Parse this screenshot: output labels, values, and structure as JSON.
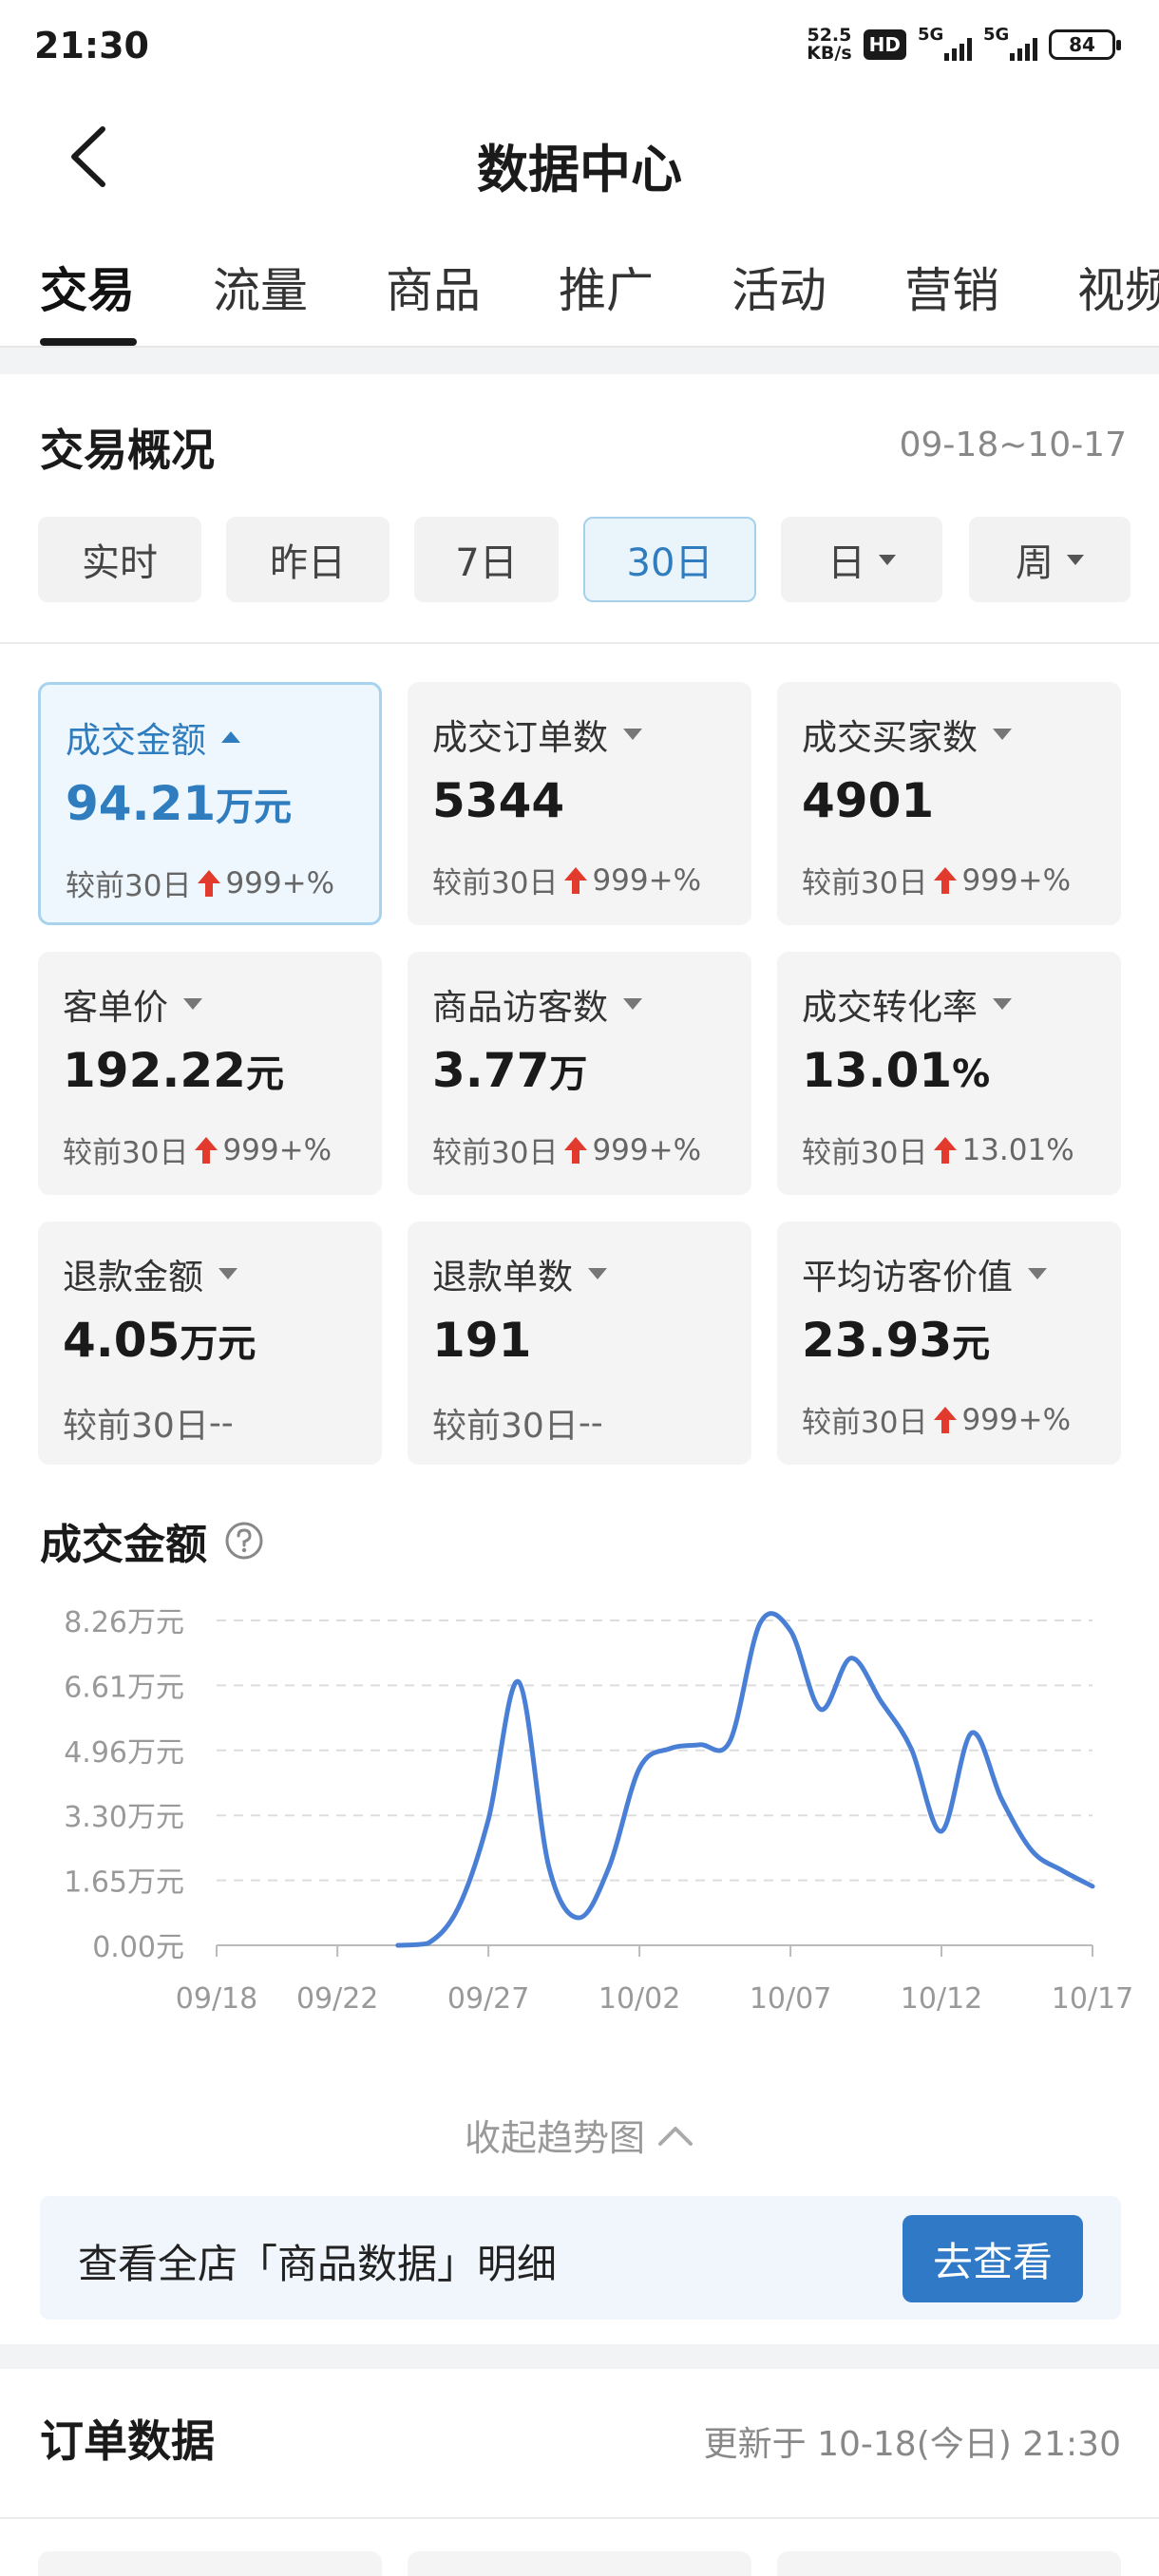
{
  "status_bar": {
    "time": "21:30",
    "net_speed": "52.5",
    "net_unit": "KB/s",
    "hd": "HD",
    "sim1": "5G",
    "sim2": "5G",
    "battery": "84"
  },
  "nav": {
    "title": "数据中心"
  },
  "tabs": [
    "交易",
    "流量",
    "商品",
    "推广",
    "活动",
    "营销",
    "视频"
  ],
  "overview": {
    "title": "交易概况",
    "date_range": "09-18~10-17",
    "chips": [
      "实时",
      "昨日",
      "7日",
      "30日",
      "日",
      "周"
    ]
  },
  "metrics": [
    {
      "label": "成交金额",
      "value": "94.21",
      "unit": "万元",
      "cmp_prefix": "较前30日",
      "cmp_value": "999+%"
    },
    {
      "label": "成交订单数",
      "value": "5344",
      "unit": "",
      "cmp_prefix": "较前30日",
      "cmp_value": "999+%"
    },
    {
      "label": "成交买家数",
      "value": "4901",
      "unit": "",
      "cmp_prefix": "较前30日",
      "cmp_value": "999+%"
    },
    {
      "label": "客单价",
      "value": "192.22",
      "unit": "元",
      "cmp_prefix": "较前30日",
      "cmp_value": "999+%"
    },
    {
      "label": "商品访客数",
      "value": "3.77",
      "unit": "万",
      "cmp_prefix": "较前30日",
      "cmp_value": "999+%"
    },
    {
      "label": "成交转化率",
      "value": "13.01",
      "unit": "%",
      "cmp_prefix": "较前30日",
      "cmp_value": "13.01%"
    },
    {
      "label": "退款金额",
      "value": "4.05",
      "unit": "万元",
      "cmp_prefix": "较前30日",
      "cmp_value": "--"
    },
    {
      "label": "退款单数",
      "value": "191",
      "unit": "",
      "cmp_prefix": "较前30日",
      "cmp_value": "--"
    },
    {
      "label": "平均访客价值",
      "value": "23.93",
      "unit": "元",
      "cmp_prefix": "较前30日",
      "cmp_value": "999+%"
    }
  ],
  "colors": {
    "accent": "#2f7dbf",
    "line": "#4a7fd6",
    "up_arrow": "#e23b2e",
    "button": "#2f79c6"
  },
  "chart_title": "成交金额",
  "chart_data": {
    "type": "line",
    "title": "成交金额",
    "x": [
      "09/18",
      "09/19",
      "09/20",
      "09/21",
      "09/22",
      "09/23",
      "09/24",
      "09/25",
      "09/26",
      "09/27",
      "09/28",
      "09/29",
      "09/30",
      "10/01",
      "10/02",
      "10/03",
      "10/04",
      "10/05",
      "10/06",
      "10/07",
      "10/08",
      "10/09",
      "10/10",
      "10/11",
      "10/12",
      "10/13",
      "10/14",
      "10/15",
      "10/16",
      "10/17"
    ],
    "x_ticks": [
      "09/18",
      "09/22",
      "09/27",
      "10/02",
      "10/07",
      "10/12",
      "10/17"
    ],
    "y_ticks": [
      "0.00元",
      "1.65万元",
      "3.30万元",
      "4.96万元",
      "6.61万元",
      "8.26万元"
    ],
    "ylim": [
      0,
      8.26
    ],
    "y_unit": "万元",
    "grid": true,
    "series": [
      {
        "values": [
          null,
          null,
          null,
          null,
          null,
          null,
          0,
          0.05,
          0.95,
          3.2,
          6.7,
          2.0,
          0.7,
          2.0,
          4.5,
          5.0,
          5.1,
          5.2,
          8.2,
          8.0,
          6.0,
          7.3,
          6.2,
          5.0,
          2.9,
          5.4,
          3.7,
          2.4,
          1.9,
          1.5
        ]
      }
    ]
  },
  "collapse_label": "收起趋势图",
  "banner": {
    "text": "查看全店「商品数据」明细",
    "button": "去查看"
  },
  "order": {
    "title": "订单数据",
    "updated": "更新于 10-18(今日) 21:30"
  }
}
